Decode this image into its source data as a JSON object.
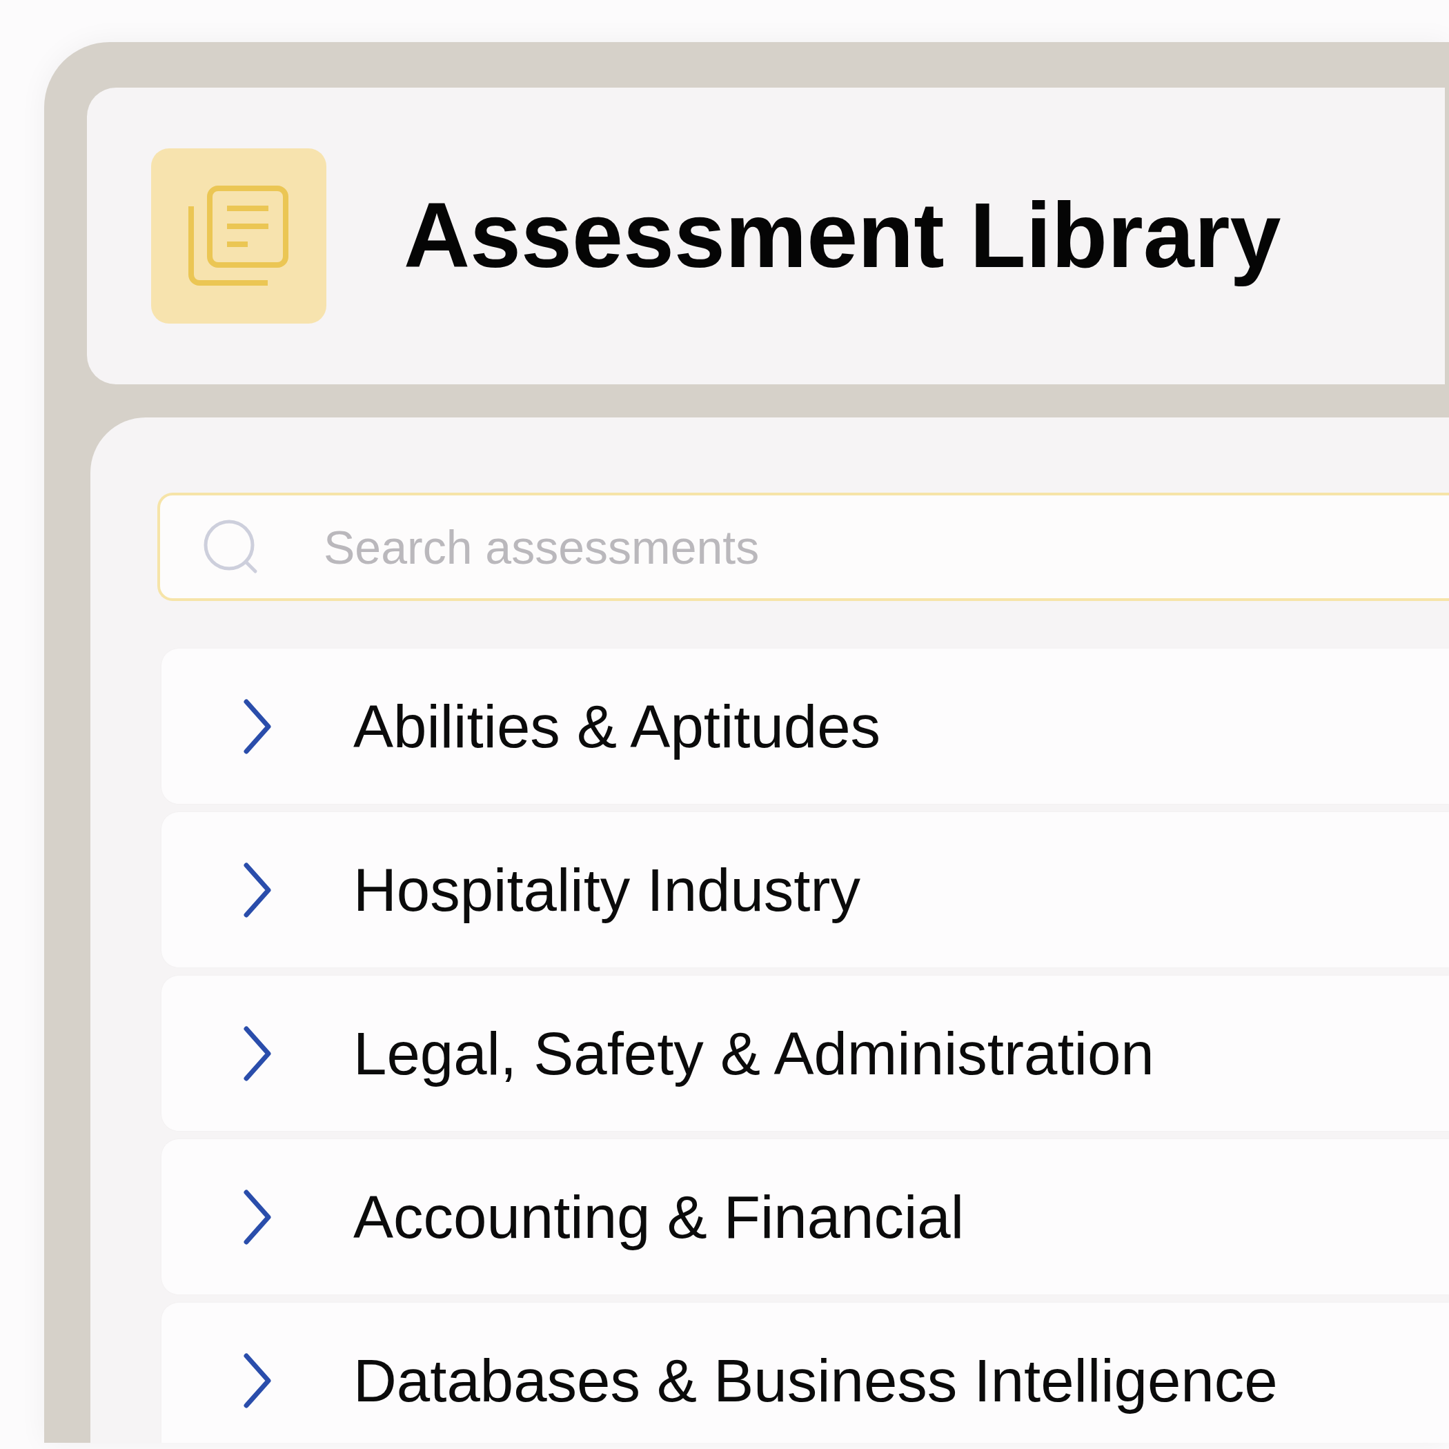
{
  "header": {
    "title": "Assessment Library"
  },
  "search": {
    "placeholder": "Search assessments"
  },
  "categories": [
    {
      "label": "Abilities & Aptitudes",
      "expanded": false
    },
    {
      "label": "Hospitality Industry",
      "expanded": false
    },
    {
      "label": "Legal, Safety & Administration",
      "expanded": false
    },
    {
      "label": "Accounting & Financial",
      "expanded": false
    },
    {
      "label": "Databases & Business Intelligence",
      "expanded": false
    }
  ]
}
